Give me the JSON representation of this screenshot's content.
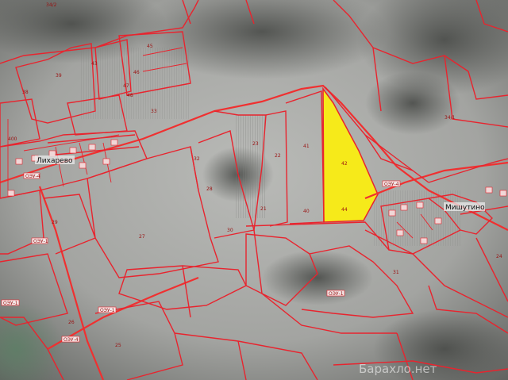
{
  "places": {
    "village_west": "Лихарево",
    "village_east": "Мишутино"
  },
  "parcel_labels": {
    "p1": "34/2",
    "p2": "34/1",
    "p3": "43",
    "p4": "39",
    "p5": "38",
    "p6": "45",
    "p7": "46",
    "p8": "47",
    "p9": "48",
    "p10": "41",
    "p11": "40",
    "p12": "400",
    "p13": "42",
    "p14": "44",
    "p15": "33",
    "p16": "32",
    "p17": "28",
    "p18": "31",
    "p19": "27",
    "p20": "30",
    "p21": "29",
    "p22": "26",
    "p23": "25",
    "p24": "24",
    "p25": "23",
    "p26": "22",
    "p27": "21"
  },
  "road_tags": {
    "t1": "ОЭУ-4",
    "t2": "ОЭУ-4",
    "t3": "ОЭУ-1",
    "t4": "ОЭУ-1",
    "t5": "ОЭУ-4",
    "t6": "ОЭУ-1",
    "t7": "ОЭУ-1"
  },
  "watermark": "Барахло.нет",
  "colors": {
    "boundary": "#e8242e",
    "highlight_parcel": "#f6ea1a"
  }
}
